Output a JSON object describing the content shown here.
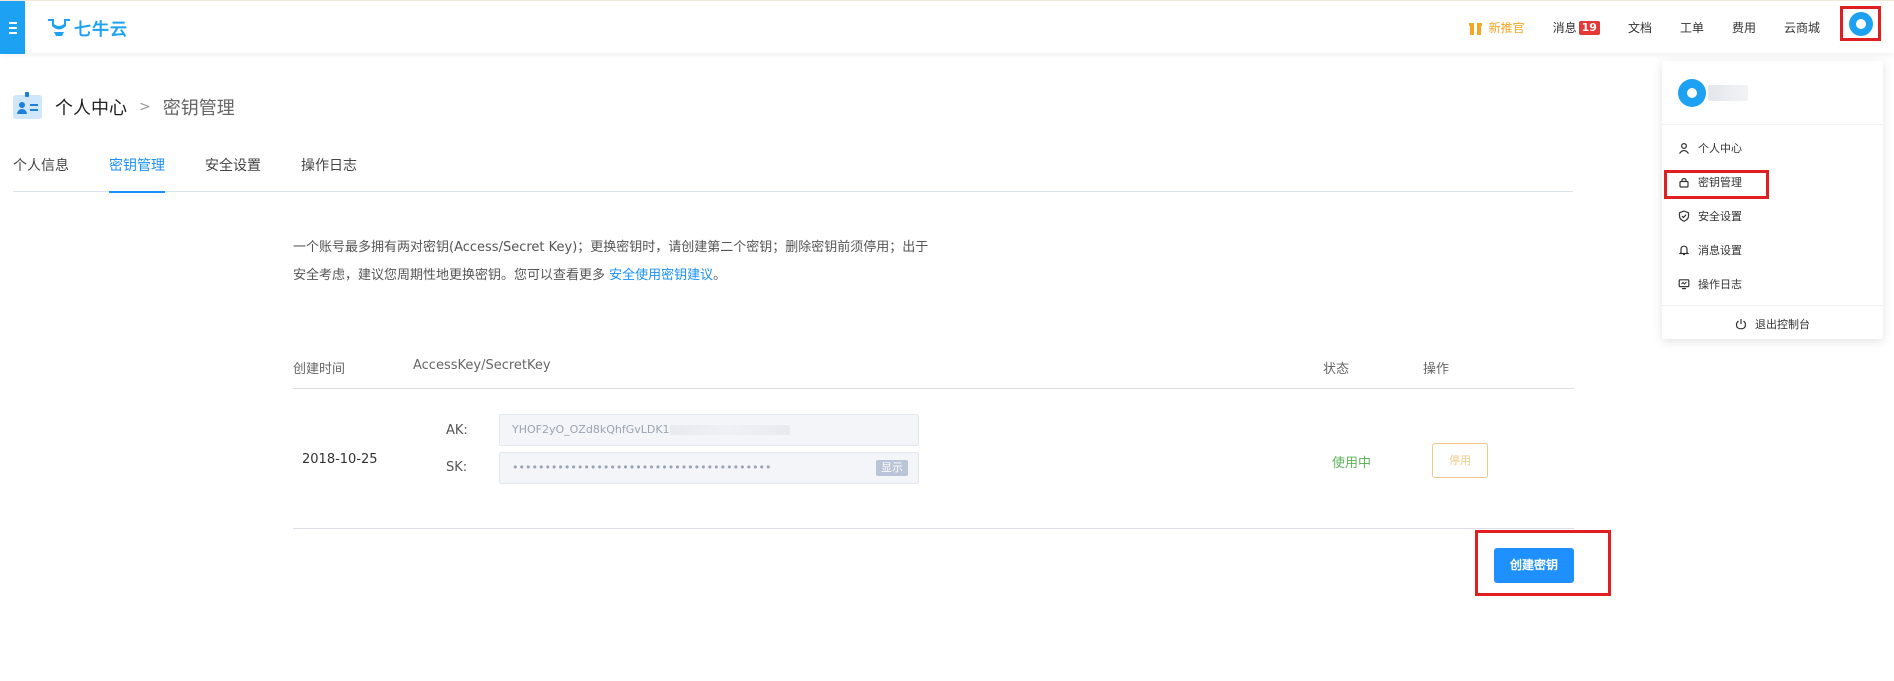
{
  "header": {
    "logo_text": "七牛云",
    "nav": [
      {
        "label": "新推官",
        "type": "promo"
      },
      {
        "label": "消息",
        "badge": "19"
      },
      {
        "label": "文档"
      },
      {
        "label": "工单"
      },
      {
        "label": "费用"
      },
      {
        "label": "云商城"
      }
    ]
  },
  "breadcrumb": {
    "main": "个人中心",
    "separator": ">",
    "current": "密钥管理"
  },
  "tabs": [
    {
      "label": "个人信息",
      "active": false
    },
    {
      "label": "密钥管理",
      "active": true
    },
    {
      "label": "安全设置",
      "active": false
    },
    {
      "label": "操作日志",
      "active": false
    }
  ],
  "info": {
    "text": "一个账号最多拥有两对密钥(Access/Secret Key)；更换密钥时，请创建第二个密钥；删除密钥前须停用；出于安全考虑，建议您周期性地更换密钥。您可以查看更多 ",
    "link": "安全使用密钥建议",
    "end": "。"
  },
  "table": {
    "headers": [
      "创建时间",
      "AccessKey/SecretKey",
      "状态",
      "操作"
    ],
    "rows": [
      {
        "date": "2018-10-25",
        "ak_label": "AK:",
        "ak_value": "YHOF2yO_OZd8kQhfGvLDK1",
        "sk_label": "SK:",
        "sk_value": "••••••••••••••••••••••••••••••••••••••••",
        "show_label": "显示",
        "status": "使用中",
        "action": "停用"
      }
    ]
  },
  "create_button": "创建密钥",
  "dropdown": {
    "items": [
      {
        "label": "个人中心",
        "icon": "user-icon"
      },
      {
        "label": "密钥管理",
        "icon": "lock-icon"
      },
      {
        "label": "安全设置",
        "icon": "shield-icon"
      },
      {
        "label": "消息设置",
        "icon": "bell-icon"
      },
      {
        "label": "操作日志",
        "icon": "monitor-icon"
      }
    ],
    "logout": "退出控制台"
  },
  "colors": {
    "brand": "#1da1f2",
    "accent": "#1890ff",
    "highlight": "#e02020",
    "status_ok": "#5ab45a",
    "warn": "#f0c98a"
  }
}
